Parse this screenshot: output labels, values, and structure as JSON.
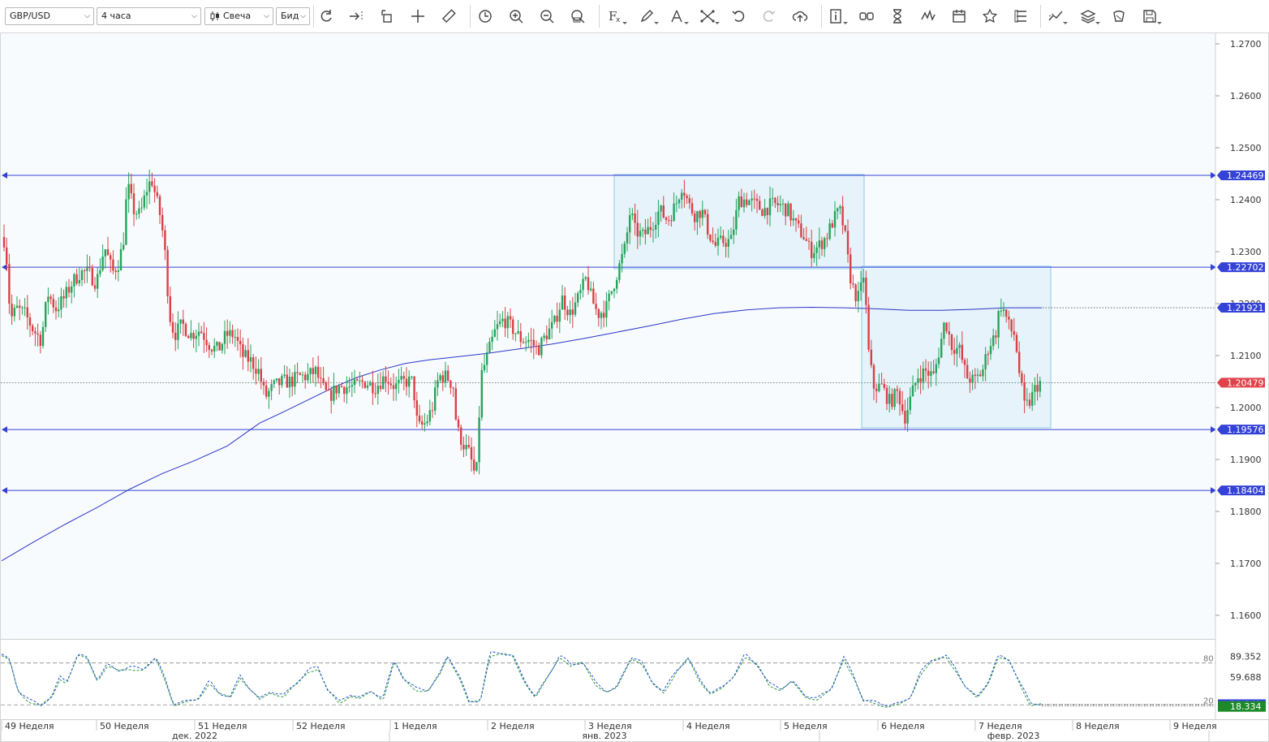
{
  "toolbar": {
    "symbol": "GBP/USD",
    "timeframe": "4 часа",
    "chart_type": "Свеча",
    "price_type": "Бид",
    "tools": [
      "refresh-icon",
      "scroll-to-end-icon",
      "autoscale-icon",
      "crosshair-icon",
      "ruler-icon",
      "clock-icon",
      "zoom-in-icon",
      "zoom-out-icon",
      "zoom-fit-icon",
      "indicators-icon",
      "pencil-icon",
      "drawing-tools-icon",
      "patterns-icon",
      "undo-icon",
      "redo-icon",
      "upload-icon",
      "info-icon",
      "compare-icon",
      "hourglass-icon",
      "wave-icon",
      "calendar-icon",
      "star-icon",
      "object-list-icon",
      "trend-icon",
      "layers-icon",
      "templates-icon",
      "save-icon"
    ]
  },
  "colors": {
    "bull": "#26a35b",
    "bear": "#d94045",
    "level_line": "#3442d6",
    "tag_blue": "#3442d6",
    "tag_red": "#e0434b",
    "ma": "#2c35c9",
    "box_fill": "#e6f3fa",
    "box_stroke": "#8cc9e8",
    "stoch_k": "#2a58d0",
    "stoch_d": "#2e9a3e",
    "tag_green": "#1d8a2a"
  },
  "price_axis": {
    "ticks": [
      "1.2700",
      "1.2600",
      "1.2500",
      "1.2400",
      "1.2300",
      "1.2200",
      "1.2100",
      "1.2000",
      "1.1900",
      "1.1800",
      "1.1700",
      "1.1600"
    ],
    "range": [
      1.1555,
      1.2755
    ]
  },
  "levels": {
    "level_1": "1.24469",
    "level_2": "1.22702",
    "level_3": "1.19576",
    "level_4": "1.18404",
    "ma_value": "1.21921",
    "current_price": "1.20479"
  },
  "stochastic": {
    "upper_level": "80",
    "lower_level": "20",
    "tick_1": "89.352",
    "tick_2": "59.688",
    "value_k": "18.334",
    "value_d": "20.943"
  },
  "time_axis": {
    "weeks": [
      "49 Неделя",
      "50 Неделя",
      "51 Неделя",
      "52 Неделя",
      "1 Неделя",
      "2 Неделя",
      "3 Неделя",
      "4 Неделя",
      "5 Неделя",
      "6 Неделя",
      "7 Неделя",
      "8 Неделя",
      "9 Неделя"
    ],
    "months": [
      "дек. 2022",
      "янв. 2023",
      "февр. 2023"
    ]
  }
}
